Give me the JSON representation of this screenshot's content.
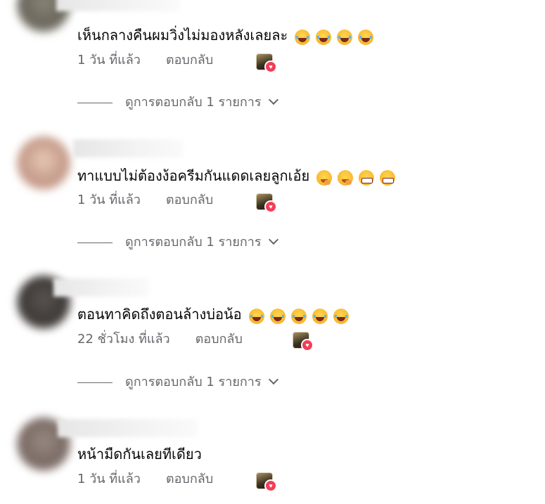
{
  "comments": [
    {
      "text": "เห็นกลางคืนผมวิ่งไม่มองหลังเลยละ",
      "emoji_names": [
        "rolling-laughing-face",
        "rolling-laughing-face",
        "rolling-laughing-face",
        "rolling-laughing-face"
      ],
      "time": "1 วัน ที่แล้ว",
      "reply_label": "ตอบกลับ",
      "reaction": "heart",
      "view_replies": "ดูการตอบกลับ 1 รายการ"
    },
    {
      "text": "ทาแบบไม่ต้องง้อครีมกันแดดเลยลูกเอ้ย",
      "emoji_names": [
        "face-with-hand-over-mouth",
        "face-with-hand-over-mouth",
        "grinning-face",
        "grinning-face"
      ],
      "time": "1 วัน ที่แล้ว",
      "reply_label": "ตอบกลับ",
      "reaction": "heart",
      "view_replies": "ดูการตอบกลับ 1 รายการ"
    },
    {
      "text": "ตอนทาคิดถึงตอนล้างบ่อน้อ",
      "emoji_names": [
        "rolling-laughing-face",
        "rolling-laughing-face",
        "rolling-laughing-face",
        "rolling-laughing-face",
        "rolling-laughing-face"
      ],
      "time": "22 ชั่วโมง ที่แล้ว",
      "reply_label": "ตอบกลับ",
      "reaction": "heart",
      "view_replies": "ดูการตอบกลับ 1 รายการ"
    },
    {
      "text": "หน้ามืดกันเลยทีเดียว",
      "emoji_names": [],
      "time": "1 วัน ที่แล้ว",
      "reply_label": "ตอบกลับ",
      "reaction": "heart"
    }
  ],
  "colors": {
    "text": "#050505",
    "secondary": "#65676b",
    "heart": "#f33e58",
    "emoji_yellow": "#ffd84d"
  }
}
